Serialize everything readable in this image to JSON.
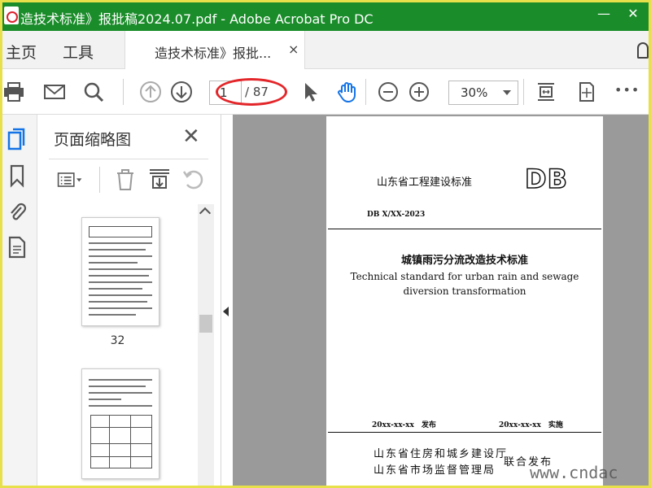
{
  "window": {
    "title": "造技术标准》报批稿2024.07.pdf - Adobe Acrobat Pro DC",
    "minimize": "—",
    "close": "✕",
    "title_bar_color": "#1a8c2a"
  },
  "tabs": {
    "home": "主页",
    "tools": "工具",
    "document": "造技术标准》报批...",
    "document_close": "×"
  },
  "toolbar": {
    "page_current": "1",
    "page_total": "/ 87",
    "zoom": "30%",
    "more": "•••"
  },
  "thumbnail_panel": {
    "title": "页面缩略图",
    "close": "✕",
    "thumbnails": [
      {
        "page_label": "32"
      },
      {
        "page_label": ""
      }
    ]
  },
  "document_page": {
    "issuer_top": "山东省工程建设标准",
    "db_mark": "DB",
    "code": "DB X/XX-2023",
    "title_cn": "城镇雨污分流改造技术标准",
    "title_en_line1": "Technical standard for urban rain and sewage",
    "title_en_line2": "diversion transformation",
    "publish_date": "20xx-xx-xx　发布",
    "implement_date": "20xx-xx-xx　实施",
    "issuer_line1": "山东省住房和城乡建设厅",
    "issuer_line2": "山东省市场监督管理局",
    "joint_release": "联合发布"
  },
  "watermark": {
    "url": "www.cndac"
  },
  "colors": {
    "annotation_ellipse": "#e3262a",
    "hand_tool_accent": "#1473e6"
  }
}
